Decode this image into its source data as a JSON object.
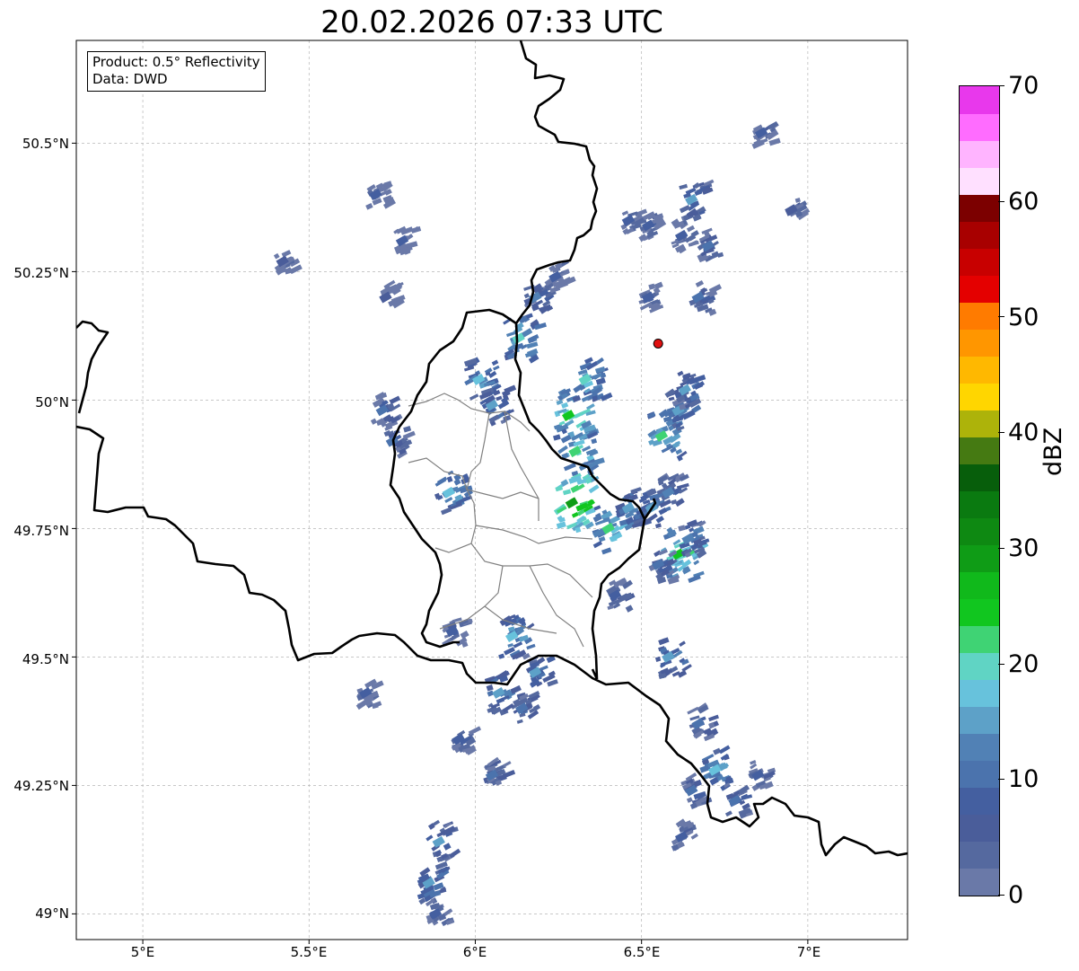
{
  "title": "20.02.2026 07:33 UTC",
  "info": {
    "product_line": "Product: 0.5° Reflectivity",
    "data_line": "Data: DWD"
  },
  "axes": {
    "lat_labels": [
      "50.5°N",
      "50.25°N",
      "50°N",
      "49.75°N",
      "49.5°N",
      "49.25°N",
      "49°N"
    ],
    "lon_labels": [
      "5°E",
      "5.5°E",
      "6°E",
      "6.5°E",
      "7°E"
    ],
    "lat_values": [
      50.5,
      50.25,
      50.0,
      49.75,
      49.5,
      49.25,
      49.0
    ],
    "lon_values": [
      5.0,
      5.5,
      6.0,
      6.5,
      7.0
    ],
    "lon_range": [
      4.8,
      7.3
    ],
    "lat_range": [
      48.95,
      50.7
    ],
    "grid": true
  },
  "radar_site": {
    "lon": 6.55,
    "lat": 50.11,
    "color": "#e01010"
  },
  "colorbar": {
    "title": "dBZ",
    "min": 0,
    "max": 70,
    "tick_labels": [
      "0",
      "10",
      "20",
      "30",
      "40",
      "50",
      "60",
      "70"
    ],
    "colors": [
      "#6a79a8",
      "#55699f",
      "#4a5d9a",
      "#445fa0",
      "#4b73ad",
      "#5181b5",
      "#5da1c8",
      "#67c2dc",
      "#60d4c4",
      "#3fd374",
      "#11c61f",
      "#10b91b",
      "#0f9c16",
      "#0e8912",
      "#0a7a10",
      "#075e0b",
      "#457a12",
      "#adb30a",
      "#ffd600",
      "#ffb800",
      "#ff9600",
      "#ff7b00",
      "#e40000",
      "#c80000",
      "#a80000",
      "#7c0000",
      "#ffe0ff",
      "#ffb4ff",
      "#ff6cff",
      "#e838ec"
    ]
  },
  "echo_cells": [
    {
      "lon": 5.7,
      "lat": 50.4,
      "dbz": 8
    },
    {
      "lon": 5.42,
      "lat": 50.27,
      "dbz": 6
    },
    {
      "lon": 5.78,
      "lat": 50.31,
      "dbz": 7
    },
    {
      "lon": 5.73,
      "lat": 50.2,
      "dbz": 6
    },
    {
      "lon": 5.72,
      "lat": 49.98,
      "dbz": 11
    },
    {
      "lon": 5.75,
      "lat": 49.92,
      "dbz": 10
    },
    {
      "lon": 5.92,
      "lat": 49.82,
      "dbz": 18
    },
    {
      "lon": 6.01,
      "lat": 50.04,
      "dbz": 17
    },
    {
      "lon": 6.05,
      "lat": 49.99,
      "dbz": 14
    },
    {
      "lon": 6.13,
      "lat": 50.12,
      "dbz": 20
    },
    {
      "lon": 6.18,
      "lat": 50.2,
      "dbz": 12
    },
    {
      "lon": 6.28,
      "lat": 49.97,
      "dbz": 24
    },
    {
      "lon": 6.3,
      "lat": 49.9,
      "dbz": 22
    },
    {
      "lon": 6.33,
      "lat": 50.04,
      "dbz": 19
    },
    {
      "lon": 6.29,
      "lat": 49.8,
      "dbz": 30
    },
    {
      "lon": 6.4,
      "lat": 49.75,
      "dbz": 21
    },
    {
      "lon": 6.46,
      "lat": 49.79,
      "dbz": 16
    },
    {
      "lon": 6.53,
      "lat": 49.79,
      "dbz": 15
    },
    {
      "lon": 6.56,
      "lat": 49.93,
      "dbz": 22
    },
    {
      "lon": 6.61,
      "lat": 49.98,
      "dbz": 16
    },
    {
      "lon": 6.63,
      "lat": 50.02,
      "dbz": 14
    },
    {
      "lon": 6.58,
      "lat": 49.82,
      "dbz": 12
    },
    {
      "lon": 6.61,
      "lat": 49.7,
      "dbz": 25
    },
    {
      "lon": 6.55,
      "lat": 49.68,
      "dbz": 11
    },
    {
      "lon": 6.64,
      "lat": 49.73,
      "dbz": 13
    },
    {
      "lon": 6.46,
      "lat": 50.35,
      "dbz": 7
    },
    {
      "lon": 6.52,
      "lat": 50.34,
      "dbz": 8
    },
    {
      "lon": 6.62,
      "lat": 50.32,
      "dbz": 9
    },
    {
      "lon": 6.65,
      "lat": 50.39,
      "dbz": 14
    },
    {
      "lon": 6.7,
      "lat": 50.3,
      "dbz": 10
    },
    {
      "lon": 6.52,
      "lat": 50.2,
      "dbz": 9
    },
    {
      "lon": 6.67,
      "lat": 50.2,
      "dbz": 10
    },
    {
      "lon": 6.24,
      "lat": 50.24,
      "dbz": 7
    },
    {
      "lon": 5.93,
      "lat": 49.55,
      "dbz": 9
    },
    {
      "lon": 6.11,
      "lat": 49.54,
      "dbz": 18
    },
    {
      "lon": 6.18,
      "lat": 49.47,
      "dbz": 14
    },
    {
      "lon": 6.07,
      "lat": 49.43,
      "dbz": 16
    },
    {
      "lon": 6.14,
      "lat": 49.4,
      "dbz": 11
    },
    {
      "lon": 5.67,
      "lat": 49.43,
      "dbz": 8
    },
    {
      "lon": 5.95,
      "lat": 49.34,
      "dbz": 9
    },
    {
      "lon": 6.05,
      "lat": 49.27,
      "dbz": 10
    },
    {
      "lon": 5.89,
      "lat": 49.14,
      "dbz": 14
    },
    {
      "lon": 5.86,
      "lat": 49.06,
      "dbz": 15
    },
    {
      "lon": 5.88,
      "lat": 49.0,
      "dbz": 9
    },
    {
      "lon": 6.65,
      "lat": 49.24,
      "dbz": 10
    },
    {
      "lon": 6.72,
      "lat": 49.28,
      "dbz": 18
    },
    {
      "lon": 6.62,
      "lat": 49.15,
      "dbz": 9
    },
    {
      "lon": 6.78,
      "lat": 49.22,
      "dbz": 11
    },
    {
      "lon": 6.85,
      "lat": 49.27,
      "dbz": 8
    },
    {
      "lon": 6.67,
      "lat": 49.37,
      "dbz": 11
    },
    {
      "lon": 6.58,
      "lat": 49.5,
      "dbz": 15
    },
    {
      "lon": 6.42,
      "lat": 49.62,
      "dbz": 9
    },
    {
      "lon": 6.86,
      "lat": 50.52,
      "dbz": 7
    },
    {
      "lon": 6.95,
      "lat": 50.37,
      "dbz": 6
    }
  ]
}
